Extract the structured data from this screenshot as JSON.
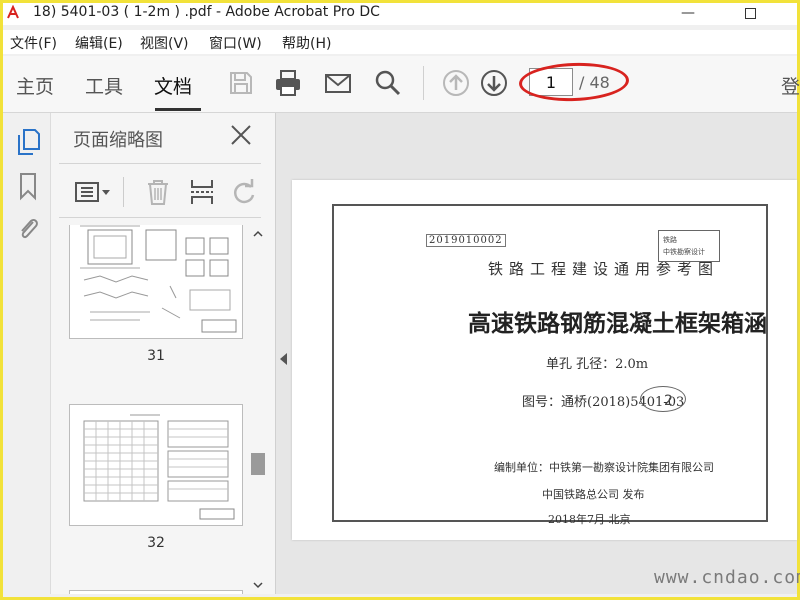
{
  "window": {
    "title": "18) 5401-03 ( 1-2m ) .pdf - Adobe Acrobat Pro DC",
    "minimize_glyph": "—"
  },
  "menu": [
    "文件(F)",
    "编辑(E)",
    "视图(V)",
    "窗口(W)",
    "帮助(H)"
  ],
  "nav_tabs": [
    "主页",
    "工具",
    "文档"
  ],
  "active_tab": "文档",
  "toolbar": {
    "icons": [
      "save-icon",
      "print-icon",
      "email-icon",
      "search-icon",
      "page-up-icon",
      "page-down-icon"
    ],
    "current_page": "1",
    "total_pages": "/ 48",
    "signin_label": "登"
  },
  "sidebar_icons": [
    "page-thumbnails-icon",
    "bookmarks-icon",
    "attachments-icon"
  ],
  "thumbnail_panel": {
    "title": "页面缩略图",
    "tools": [
      "thumbnail-options-icon",
      "delete-page-icon",
      "insert-page-icon",
      "rotate-page-icon"
    ],
    "thumbnails": [
      {
        "label": "31"
      },
      {
        "label": "32"
      }
    ]
  },
  "document": {
    "code": "2019010002",
    "series": "铁路工程建设通用参考图",
    "title": "高速铁路钢筋混凝土框架箱涵",
    "spec": "单孔  孔径：2.0m",
    "drawing_no": "图号：通桥(2018)5401-03",
    "editor": "编制单位：中铁第一勘察设计院集团有限公司",
    "publisher": "中国铁路总公司   发布",
    "date": "2018年7月      北京",
    "stamp_lines": [
      "铁路",
      "中铁勘察设计"
    ],
    "stamp_number": "2"
  },
  "watermark": "www.cndao.com",
  "colors": {
    "frame": "#f2e23a",
    "annotation_circle": "#d8231f"
  }
}
